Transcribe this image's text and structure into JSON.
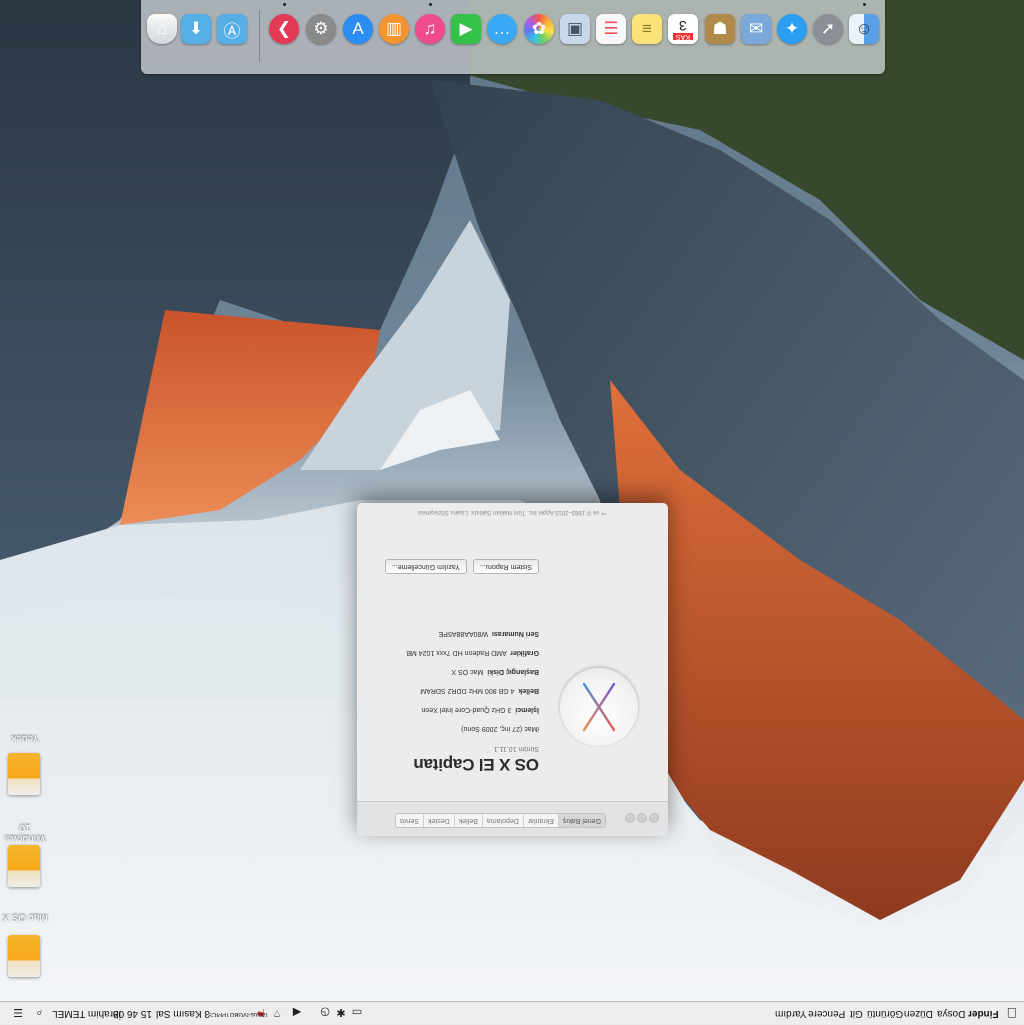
{
  "dock": {
    "apps": [
      {
        "name": "finder-folder",
        "icon": "trash-icon",
        "color": "#e9ecef"
      },
      {
        "name": "downloads-stack",
        "icon": "downloads-icon",
        "color": "#56aee6"
      },
      {
        "name": "applications-stack",
        "icon": "applications-icon",
        "color": "#56aee6"
      },
      {
        "name": "kodi",
        "icon": "kodi-icon",
        "color": "#e33b55"
      },
      {
        "name": "system-preferences",
        "icon": "gear-icon",
        "color": "#8a8a8a"
      },
      {
        "name": "app-store",
        "icon": "appstore-icon",
        "color": "#2b8cf2"
      },
      {
        "name": "ibooks",
        "icon": "book-icon",
        "color": "#f49430"
      },
      {
        "name": "itunes",
        "icon": "music-icon",
        "color": "#f04b8c"
      },
      {
        "name": "facetime",
        "icon": "facetime-icon",
        "color": "#35c24a"
      },
      {
        "name": "messages",
        "icon": "messages-icon",
        "color": "#3aa8f2"
      },
      {
        "name": "photos",
        "icon": "photos-icon",
        "color": "#f5f5f5"
      },
      {
        "name": "preview",
        "icon": "preview-icon",
        "color": "#c8d7ea"
      },
      {
        "name": "reminders",
        "icon": "reminders-icon",
        "color": "#f8f8f8"
      },
      {
        "name": "notes",
        "icon": "notes-icon",
        "color": "#fbe37a"
      },
      {
        "name": "calendar",
        "icon": "calendar-icon",
        "color": "#ffffff"
      },
      {
        "name": "contacts",
        "icon": "contacts-icon",
        "color": "#b08a4a"
      },
      {
        "name": "mail",
        "icon": "mail-icon",
        "color": "#7aa8d8"
      },
      {
        "name": "safari",
        "icon": "safari-icon",
        "color": "#2a9df4"
      },
      {
        "name": "launchpad",
        "icon": "rocket-icon",
        "color": "#8c8f96"
      },
      {
        "name": "finder",
        "icon": "finder-icon",
        "color": "#5aa0e8"
      }
    ],
    "calendar_day": "3",
    "calendar_month": "KAS"
  },
  "menubar": {
    "menus": [
      "Finder",
      "Dosya",
      "Düzen",
      "Görüntü",
      "Git",
      "Pencere",
      "Yardım"
    ],
    "right": {
      "user": "İbrahim TEMEL",
      "clock": "15 46 08",
      "date": "3 Kasım Sal",
      "wifi_name": "Tarkus-IVGBOTPPICS"
    }
  },
  "desktop": {
    "icons": [
      {
        "label": "Yedek"
      },
      {
        "label": "Windows 10"
      },
      {
        "label": "Mac OS X"
      }
    ]
  },
  "about": {
    "tabs": [
      "Genel Bakış",
      "Ekranlar",
      "Depolama",
      "Bellek",
      "Destek",
      "Servis"
    ],
    "os_title": "OS X El Capitan",
    "version": "Sürüm 10.11.1",
    "model": "iMac (27 inç, 2009 Sonu)",
    "specs": [
      {
        "label": "İşlemci",
        "value": "3 GHz Quad-Core Intel Xeon"
      },
      {
        "label": "Bellek",
        "value": "4 GB 800 MHz DDR2 SDRAM"
      },
      {
        "label": "Başlangıç Diski",
        "value": "Mac OS X"
      },
      {
        "label": "Grafikler",
        "value": "AMD Radeon HD 7xxx 1024 MB"
      },
      {
        "label": "Seri Numarası",
        "value": "W80AA88A5PE"
      }
    ],
    "buttons": {
      "report": "Sistem Raporu...",
      "update": "Yazılım Güncelleme..."
    },
    "footer": "™ ve © 1983–2015 Apple Inc. Tüm Hakları Saklıdır. Lisans Sözleşmesi"
  }
}
